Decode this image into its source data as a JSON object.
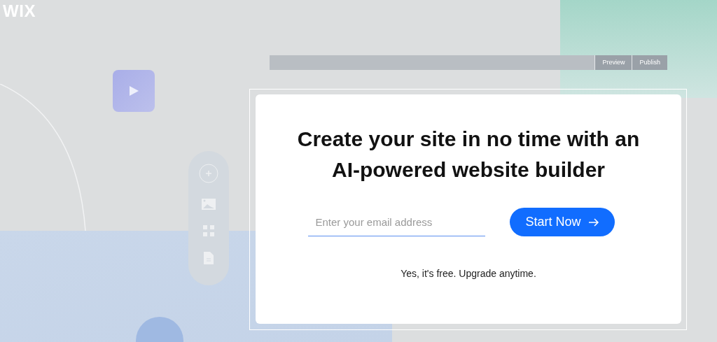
{
  "logo": "WIX",
  "editor_bar": {
    "buttons": [
      "Preview",
      "Publish"
    ]
  },
  "hero": {
    "title_lines": [
      "Create your site in no time with an",
      "AI-powered website builder"
    ],
    "email_field": {
      "placeholder": "Enter your email address"
    },
    "cta_button": {
      "label": "Start Now"
    },
    "note": "Yes, it's free. Upgrade anytime."
  }
}
